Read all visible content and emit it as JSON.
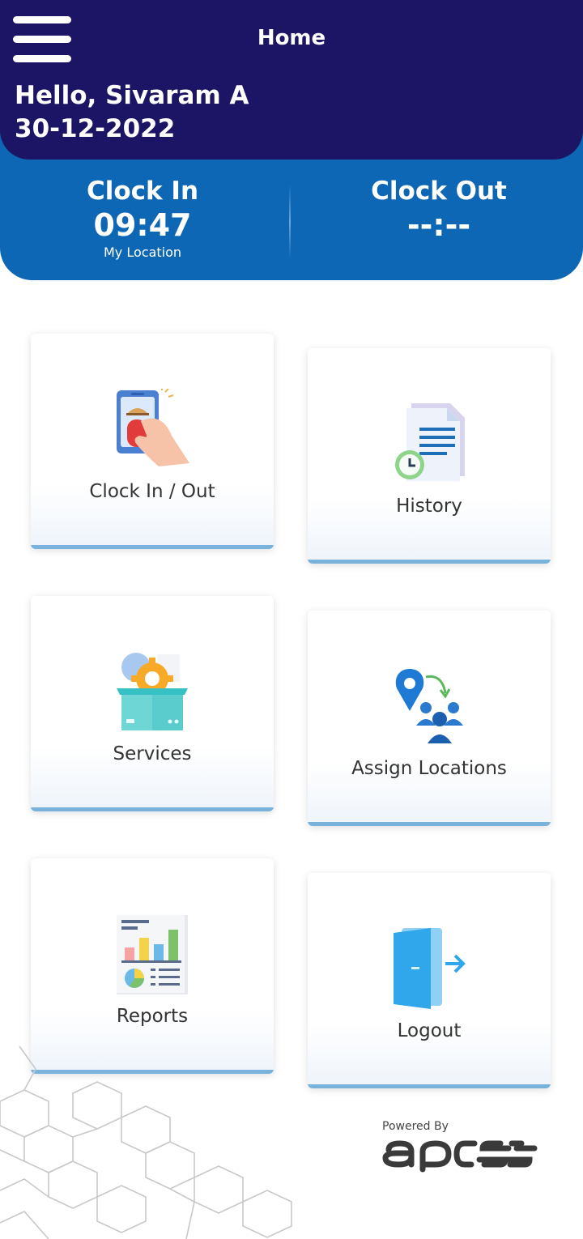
{
  "header": {
    "title": "Home",
    "greeting": "Hello, Sivaram A",
    "date": "30-12-2022",
    "menu_icon": "hamburger-menu-icon"
  },
  "clock": {
    "in_label": "Clock In",
    "in_time": "09:47",
    "in_location": "My Location",
    "out_label": "Clock Out",
    "out_time": "--:--"
  },
  "tiles": [
    {
      "label": "Clock In / Out",
      "icon": "phone-touch-icon"
    },
    {
      "label": "History",
      "icon": "document-clock-icon"
    },
    {
      "label": "Services",
      "icon": "box-gear-icon"
    },
    {
      "label": "Assign Locations",
      "icon": "location-people-icon"
    },
    {
      "label": "Reports",
      "icon": "report-chart-icon"
    },
    {
      "label": "Logout",
      "icon": "door-exit-icon"
    }
  ],
  "footer": {
    "powered_by": "Powered By",
    "brand": "apcess"
  },
  "colors": {
    "header_bg": "#1c1464",
    "clock_bg": "#0d67b5",
    "tile_accent": "#7ab2de"
  }
}
